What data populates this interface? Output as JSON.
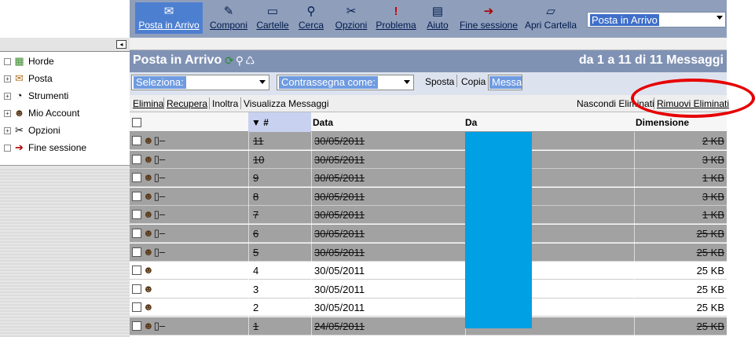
{
  "menu": {
    "items": [
      {
        "label": "Posta in Arrivo",
        "icon": "envelope-icon",
        "glyph": "✉",
        "active": true
      },
      {
        "label": "Componi",
        "icon": "compose-icon",
        "glyph": "✎"
      },
      {
        "label": "Cartelle",
        "icon": "folder-icon",
        "glyph": "▭"
      },
      {
        "label": "Cerca",
        "icon": "magnifier-icon",
        "glyph": "⚲"
      },
      {
        "label": "Opzioni",
        "icon": "tools-icon",
        "glyph": "✂"
      },
      {
        "label": "Problema",
        "icon": "exclamation-icon",
        "glyph": "!"
      },
      {
        "label": "Aiuto",
        "icon": "book-icon",
        "glyph": "▤"
      },
      {
        "label": "Fine sessione",
        "icon": "logout-icon",
        "glyph": "➔"
      },
      {
        "label": "Apri Cartella",
        "icon": "open-folder-icon",
        "glyph": "▱"
      }
    ],
    "folder_select": "Posta in Arrivo"
  },
  "sidebar": {
    "toggle": "◂",
    "items": [
      {
        "label": "Horde",
        "icon": "horde-icon",
        "glyph": "▦",
        "expand": ""
      },
      {
        "label": "Posta",
        "icon": "mail-icon",
        "glyph": "✉",
        "expand": "+"
      },
      {
        "label": "Strumenti",
        "icon": "tools-clock-icon",
        "glyph": "◔",
        "expand": "+"
      },
      {
        "label": "Mio Account",
        "icon": "user-icon",
        "glyph": "☻",
        "expand": "+"
      },
      {
        "label": "Opzioni",
        "icon": "options-icon",
        "glyph": "✂",
        "expand": "+"
      },
      {
        "label": "Fine sessione",
        "icon": "logout-icon",
        "glyph": "➔",
        "expand": ""
      }
    ]
  },
  "header": {
    "title": "Posta in Arrivo",
    "count": "da 1 a 11 di 11 Messaggi"
  },
  "controls": {
    "select_label": "Seleziona:",
    "mark_label": "Contrassegna come:",
    "move": "Sposta",
    "copy": "Copia",
    "target_value": "Messa"
  },
  "actions": {
    "delete": "Elimina",
    "recover": "Recupera",
    "forward": "Inoltra",
    "view": "Visualizza Messaggi",
    "hide_deleted": "Nascondi Eliminati",
    "purge_deleted": "Rimuovi Eliminati"
  },
  "table": {
    "columns": {
      "num": "▼ #",
      "date": "Data",
      "from": "Da",
      "size": "Dimensione"
    },
    "rows": [
      {
        "num": "11",
        "date": "30/05/2011",
        "size": "2 KB",
        "deleted": true
      },
      {
        "num": "10",
        "date": "30/05/2011",
        "size": "3 KB",
        "deleted": true
      },
      {
        "num": "9",
        "date": "30/05/2011",
        "size": "1 KB",
        "deleted": true
      },
      {
        "num": "8",
        "date": "30/05/2011",
        "size": "3 KB",
        "deleted": true
      },
      {
        "num": "7",
        "date": "30/05/2011",
        "size": "1 KB",
        "deleted": true
      },
      {
        "num": "6",
        "date": "30/05/2011",
        "size": "25 KB",
        "deleted": true
      },
      {
        "num": "5",
        "date": "30/05/2011",
        "size": "25 KB",
        "deleted": true
      },
      {
        "num": "4",
        "date": "30/05/2011",
        "size": "25 KB",
        "deleted": false
      },
      {
        "num": "3",
        "date": "30/05/2011",
        "size": "25 KB",
        "deleted": false
      },
      {
        "num": "2",
        "date": "30/05/2011",
        "size": "25 KB",
        "deleted": false
      },
      {
        "num": "1",
        "date": "24/05/2011",
        "size": "25 KB",
        "deleted": true
      }
    ]
  },
  "colors": {
    "menubar": "#8f9fbb",
    "header": "#8092b4",
    "deleted_row": "#a2a2a2",
    "redaction": "#00a0e4",
    "highlight": "#e60000"
  }
}
